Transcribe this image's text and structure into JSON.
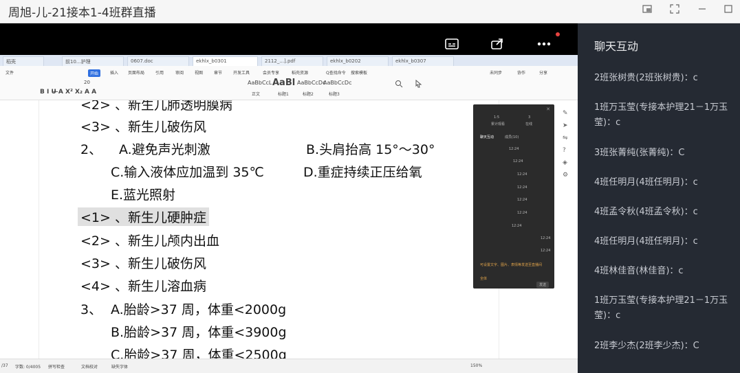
{
  "window": {
    "title": "周旭-儿-21接本1-4班群直播"
  },
  "stage_toolbar": {
    "icons": [
      "subtitle-icon",
      "share-icon",
      "more-icon"
    ]
  },
  "shared_screen": {
    "tabs": [
      "稻壳",
      "前10...护理",
      "0607.doc",
      "ekhlx_b0301",
      "2112_...].pdf",
      "ekhlx_b0202",
      "ekhlx_b0307"
    ],
    "menu": [
      "文件",
      "开始",
      "插入",
      "页面布局",
      "引用",
      "审阅",
      "视图",
      "章节",
      "开发工具",
      "会员专享",
      "稻壳资源",
      "Q查找命令",
      "搜索模板",
      "未同步",
      "协作",
      "分享"
    ],
    "styles": [
      "AaBbCcL",
      "AaBl",
      "AaBbCcDc",
      "AaBbCcDc"
    ],
    "style_captions": [
      "正文",
      "标题1",
      "标题2",
      "标题3"
    ],
    "font_size": "20",
    "lines": [
      "<2> 、新生儿肺透明膜病",
      "<3> 、新生儿破伤风",
      "2、",
      "A.避免声光刺激",
      "B.头肩抬高 15°～30°",
      "C.输入液体应加温到 35℃",
      "D.重症持续正压给氧",
      "E.蓝光照射",
      "<1> 、新生儿硬肿症",
      "<2> 、新生儿颅内出血",
      "<3> 、新生儿破伤风",
      "<4> 、新生儿溶血病",
      "3、",
      "A.胎龄>37 周，体重<2000g",
      "B.胎龄>37 周，体重<3900g",
      "C.胎龄>37 周，体重<2500g"
    ],
    "statusbar": {
      "page": "/37",
      "words": "字数: 0/4005",
      "spell": "拼写检查",
      "proof": "文档校对",
      "state": "缺失字体",
      "zoom": "150%"
    },
    "mini_chat": {
      "stats": [
        "1:5",
        "3"
      ],
      "stat_labels": [
        "累计观看",
        "在线"
      ],
      "tabs": [
        "聊天互动",
        "成员(10)"
      ],
      "times": [
        "12:24",
        "12:24",
        "12:24",
        "12:24",
        "12:24",
        "12:24",
        "12:24",
        "12:24",
        "12:24"
      ],
      "notice": "可设置文字、图片、表情等发送至直播间",
      "toggle": "全体",
      "btn": "发送"
    }
  },
  "chat_panel": {
    "title": "聊天互动",
    "messages": [
      "2班张树贵(2班张树贵)：c",
      "1班万玉莹(专接本护理21－1万玉莹)：c",
      "3班张菁纯(张菁纯)：C",
      "4班任明月(4班任明月)：c",
      "4班孟令秋(4班孟令秋)：c",
      "4班任明月(4班任明月)：c",
      "4班林佳音(林佳音)：c",
      "1班万玉莹(专接本护理21－1万玉莹)：c",
      "2班李少杰(2班李少杰)：C"
    ]
  }
}
